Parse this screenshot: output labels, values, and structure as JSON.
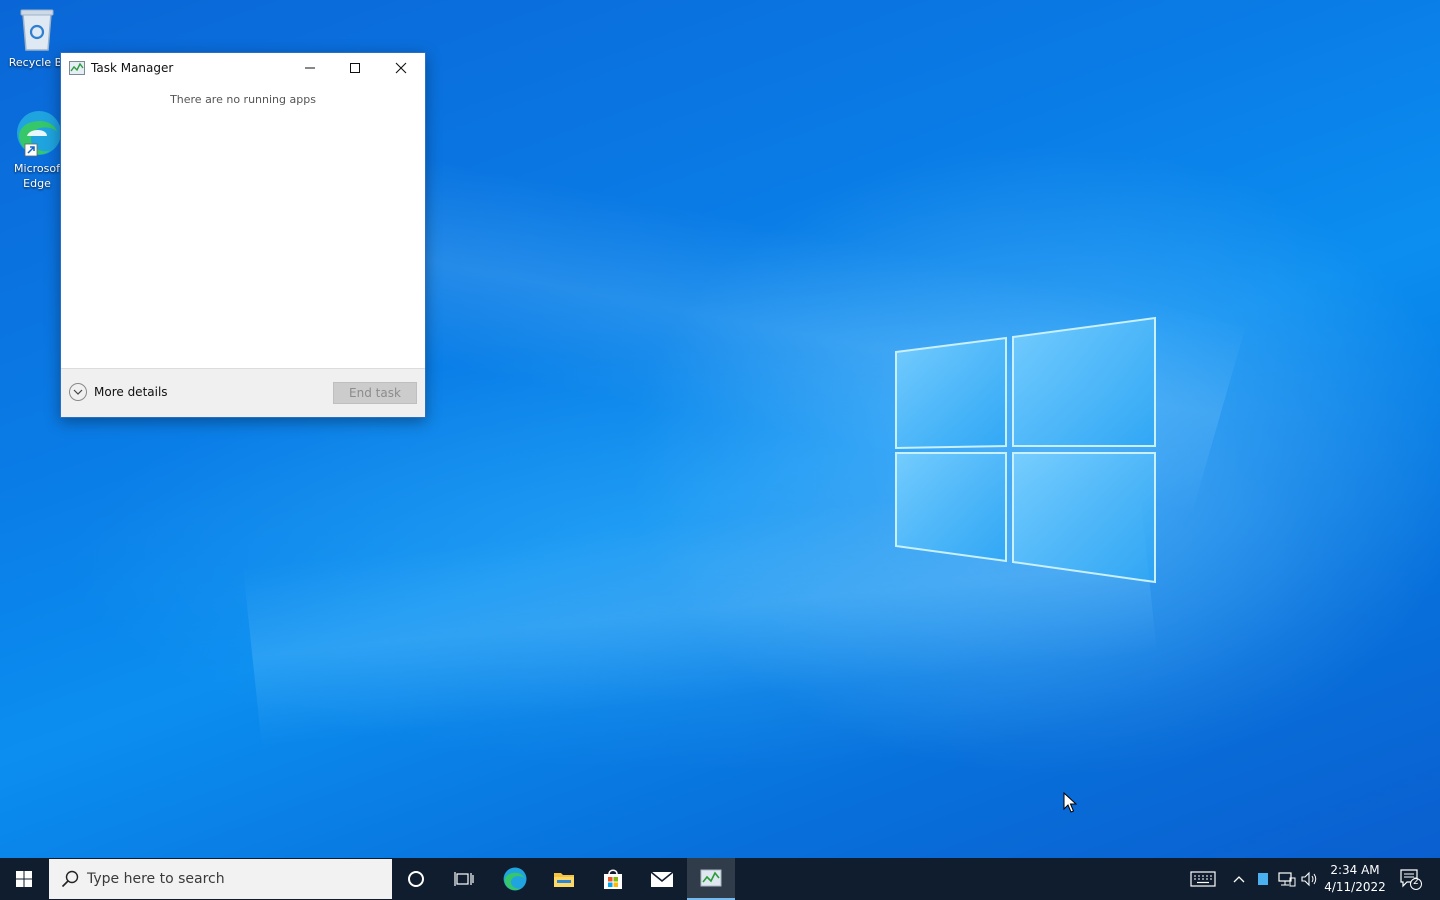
{
  "desktop": {
    "icons": [
      {
        "label": "Recycle Bi"
      },
      {
        "label_line1": "Microsof",
        "label_line2": "Edge"
      }
    ]
  },
  "task_manager": {
    "title": "Task Manager",
    "empty_message": "There are no running apps",
    "more_details_label": "More details",
    "end_task_label": "End task"
  },
  "taskbar": {
    "search_placeholder": "Type here to search",
    "clock_time": "2:34 AM",
    "clock_date": "4/11/2022",
    "notification_count": "2"
  }
}
